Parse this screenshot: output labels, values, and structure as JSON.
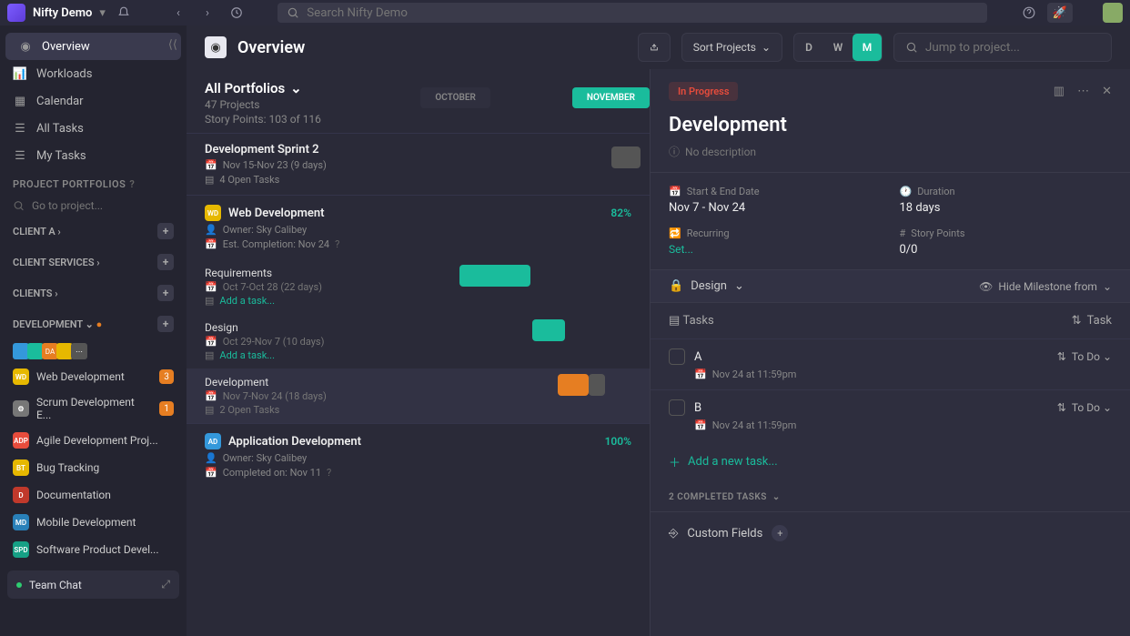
{
  "topbar": {
    "workspace": "Nifty Demo",
    "search_placeholder": "Search Nifty Demo"
  },
  "sidebar": {
    "nav": [
      {
        "label": "Overview",
        "active": true
      },
      {
        "label": "Workloads"
      },
      {
        "label": "Calendar"
      },
      {
        "label": "All Tasks"
      },
      {
        "label": "My Tasks"
      }
    ],
    "portfolios_header": "PROJECT PORTFOLIOS",
    "project_search_placeholder": "Go to project...",
    "portfolios": [
      {
        "label": "CLIENT A"
      },
      {
        "label": "CLIENT SERVICES"
      },
      {
        "label": "CLIENTS"
      },
      {
        "label": "DEVELOPMENT",
        "expanded": true,
        "dot": true
      }
    ],
    "projects": [
      {
        "label": "Web Development",
        "color": "#e6b800",
        "badge": "3",
        "code": "WD"
      },
      {
        "label": "Scrum Development E...",
        "color": "#777",
        "badge": "1",
        "code": "⚙"
      },
      {
        "label": "Agile Development Proj...",
        "color": "#e74c3c",
        "code": "ADP"
      },
      {
        "label": "Bug Tracking",
        "color": "#e6b800",
        "code": "BT"
      },
      {
        "label": "Documentation",
        "color": "#c0392b",
        "code": "D"
      },
      {
        "label": "Mobile Development",
        "color": "#2980b9",
        "code": "MD"
      },
      {
        "label": "Software Product Devel...",
        "color": "#16a085",
        "code": "SPD"
      }
    ],
    "team_chat": "Team Chat"
  },
  "header": {
    "title": "Overview",
    "sort_button": "Sort Projects",
    "view_d": "D",
    "view_w": "W",
    "view_m": "M",
    "jump_placeholder": "Jump to project..."
  },
  "timeline": {
    "portfolio_label": "All Portfolios",
    "projects_count": "47 Projects",
    "story_points": "Story Points: 103 of 116",
    "months": [
      "OCTOBER",
      "NOVEMBER"
    ],
    "groups": [
      {
        "title": "Development Sprint 2",
        "dates": "Nov 15-Nov 23 (9 days)",
        "open_tasks": "4 Open Tasks"
      },
      {
        "title": "Web Development",
        "pct": "82%",
        "icon_color": "#e6b800",
        "code": "WD",
        "owner": "Owner: Sky Calibey",
        "completion": "Est. Completion: Nov 24",
        "milestones": [
          {
            "title": "Requirements",
            "dates": "Oct 7-Oct 28 (22 days)",
            "add": "Add a task..."
          },
          {
            "title": "Design",
            "dates": "Oct 29-Nov 7 (10 days)",
            "add": "Add a task..."
          },
          {
            "title": "Development",
            "dates": "Nov 7-Nov 24 (18 days)",
            "open": "2 Open Tasks"
          }
        ]
      },
      {
        "title": "Application Development",
        "pct": "100%",
        "icon_color": "#3498db",
        "code": "AD",
        "owner": "Owner: Sky Calibey",
        "completion": "Completed on: Nov 11"
      }
    ]
  },
  "detail": {
    "status": "In Progress",
    "title": "Development",
    "no_description": "No description",
    "fields": {
      "start_end_label": "Start & End Date",
      "start_end_value": "Nov 7 - Nov 24",
      "duration_label": "Duration",
      "duration_value": "18 days",
      "recurring_label": "Recurring",
      "recurring_value": "Set...",
      "story_points_label": "Story Points",
      "story_points_value": "0/0"
    },
    "tab": "Design",
    "hide_label": "Hide Milestone from",
    "tasks_label": "Tasks",
    "task_action": "Task",
    "tasks": [
      {
        "name": "A",
        "date": "Nov 24 at 11:59pm",
        "status": "To Do"
      },
      {
        "name": "B",
        "date": "Nov 24 at 11:59pm",
        "status": "To Do"
      }
    ],
    "add_task": "Add a new task...",
    "completed": "2 COMPLETED TASKS",
    "custom_fields": "Custom Fields"
  }
}
